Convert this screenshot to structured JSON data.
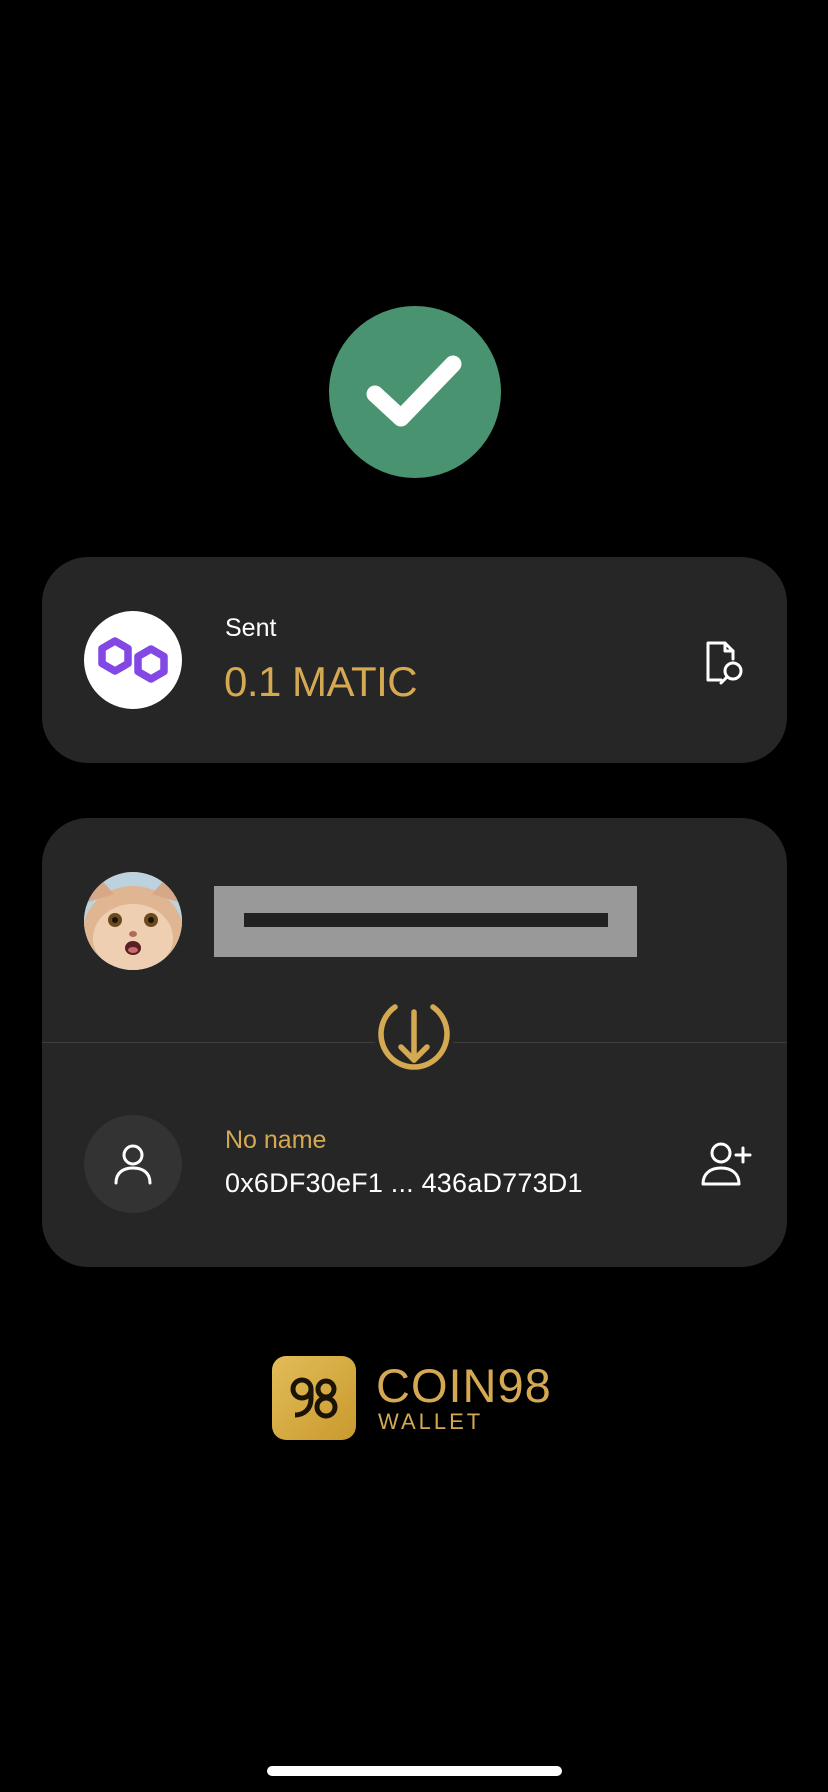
{
  "status": {
    "icon": "check-icon",
    "color": "#4a9370"
  },
  "sent_card": {
    "label": "Sent",
    "amount": "0.1 MATIC",
    "token_icon": "polygon-icon",
    "action_icon": "document-search-icon",
    "amount_color": "#d5a952"
  },
  "transfer": {
    "from": {
      "avatar": "cat-avatar",
      "name_redacted": true
    },
    "direction_icon": "arrow-down-circle-icon",
    "to": {
      "name": "No name",
      "address": "0x6DF30eF1 ... 436aD773D1",
      "avatar_icon": "user-icon",
      "action_icon": "add-user-icon"
    }
  },
  "brand": {
    "name": "COIN98",
    "sub": "WALLET",
    "logo_icon": "coin98-logo",
    "color": "#d5a952"
  }
}
